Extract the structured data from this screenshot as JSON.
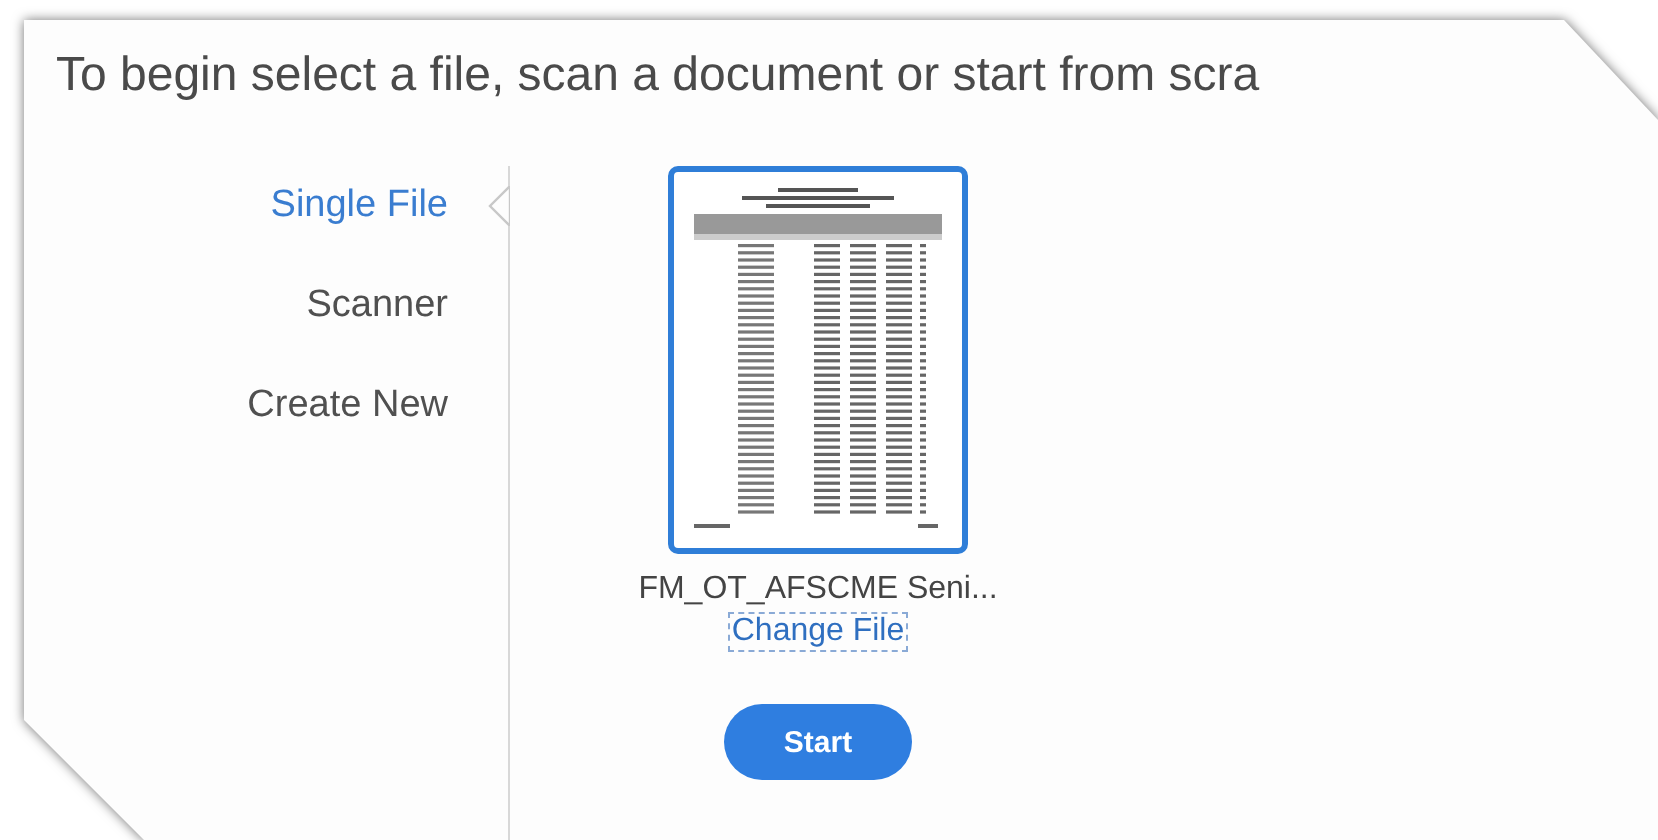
{
  "heading": "To begin select a file, scan a document or start from scra",
  "sources": [
    {
      "label": "Single File",
      "selected": true
    },
    {
      "label": "Scanner",
      "selected": false
    },
    {
      "label": "Create New",
      "selected": false
    }
  ],
  "file": {
    "name": "FM_OT_AFSCME Seni...",
    "change_link": "Change File"
  },
  "start_button": "Start"
}
